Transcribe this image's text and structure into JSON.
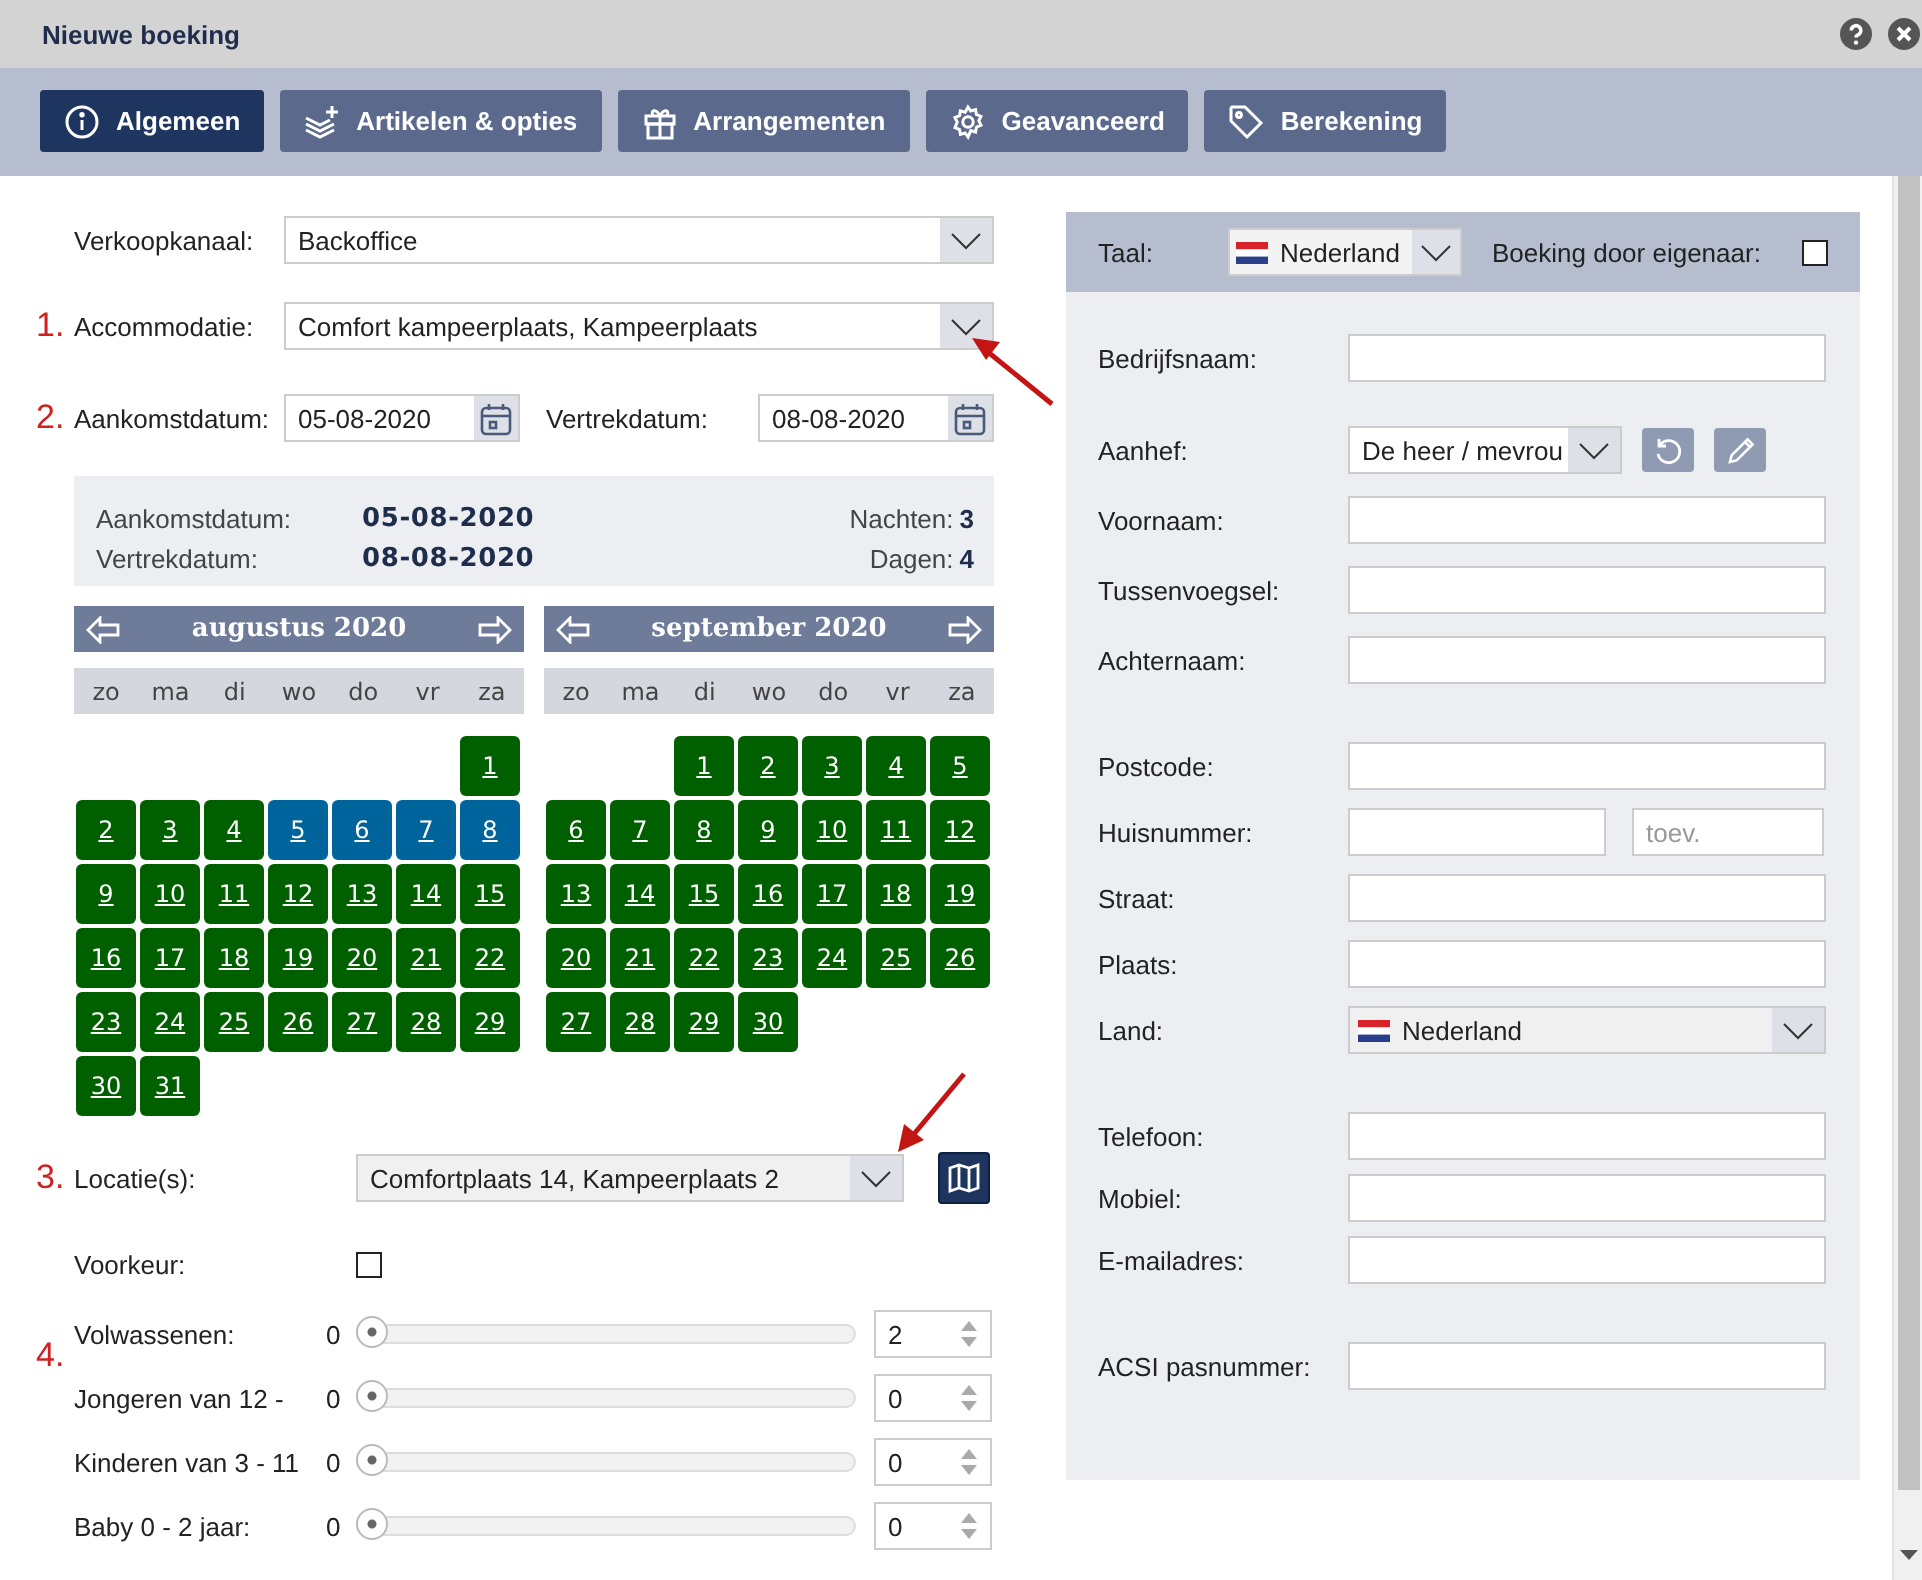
{
  "window": {
    "title": "Nieuwe boeking"
  },
  "tabs": [
    {
      "label": "Algemeen",
      "selected": true
    },
    {
      "label": "Artikelen & opties",
      "selected": false
    },
    {
      "label": "Arrangementen",
      "selected": false
    },
    {
      "label": "Geavanceerd",
      "selected": false
    },
    {
      "label": "Berekening",
      "selected": false
    }
  ],
  "booking": {
    "sales_channel": {
      "label": "Verkoopkanaal:",
      "value": "Backoffice"
    },
    "accommodation": {
      "marker": "1.",
      "label": "Accommodatie:",
      "value": "Comfort kampeerplaats, Kampeerplaats"
    },
    "dates": {
      "marker": "2.",
      "arrival_label": "Aankomstdatum:",
      "arrival": "05-08-2020",
      "departure_label": "Vertrekdatum:",
      "departure": "08-08-2020"
    },
    "summary": {
      "arrival_label": "Aankomstdatum:",
      "arrival": "05-08-2020",
      "departure_label": "Vertrekdatum:",
      "departure": "08-08-2020",
      "nights_label": "Nachten:",
      "nights": "3",
      "days_label": "Dagen:",
      "days": "4"
    },
    "calendars": [
      {
        "month": "augustus 2020",
        "weekdays": [
          "zo",
          "ma",
          "di",
          "wo",
          "do",
          "vr",
          "za"
        ],
        "weeks": [
          [
            {
              "day": "1",
              "selected": false
            }
          ],
          [
            {
              "day": "2",
              "selected": false
            },
            {
              "day": "3",
              "selected": false
            },
            {
              "day": "4",
              "selected": false
            },
            {
              "day": "5",
              "selected": true
            },
            {
              "day": "6",
              "selected": true
            },
            {
              "day": "7",
              "selected": true
            },
            {
              "day": "8",
              "selected": true
            }
          ],
          [
            {
              "day": "9",
              "selected": false
            },
            {
              "day": "10",
              "selected": false
            },
            {
              "day": "11",
              "selected": false
            },
            {
              "day": "12",
              "selected": false
            },
            {
              "day": "13",
              "selected": false
            },
            {
              "day": "14",
              "selected": false
            },
            {
              "day": "15",
              "selected": false
            }
          ],
          [
            {
              "day": "16",
              "selected": false
            },
            {
              "day": "17",
              "selected": false
            },
            {
              "day": "18",
              "selected": false
            },
            {
              "day": "19",
              "selected": false
            },
            {
              "day": "20",
              "selected": false
            },
            {
              "day": "21",
              "selected": false
            },
            {
              "day": "22",
              "selected": false
            }
          ],
          [
            {
              "day": "23",
              "selected": false
            },
            {
              "day": "24",
              "selected": false
            },
            {
              "day": "25",
              "selected": false
            },
            {
              "day": "26",
              "selected": false
            },
            {
              "day": "27",
              "selected": false
            },
            {
              "day": "28",
              "selected": false
            },
            {
              "day": "29",
              "selected": false
            }
          ],
          [
            {
              "day": "30",
              "selected": false
            },
            {
              "day": "31",
              "selected": false
            }
          ]
        ]
      },
      {
        "month": "september 2020",
        "weekdays": [
          "zo",
          "ma",
          "di",
          "wo",
          "do",
          "vr",
          "za"
        ],
        "weeks": [
          [
            {
              "day": "1",
              "selected": false
            },
            {
              "day": "2",
              "selected": false
            },
            {
              "day": "3",
              "selected": false
            },
            {
              "day": "4",
              "selected": false
            },
            {
              "day": "5",
              "selected": false
            }
          ],
          [
            {
              "day": "6",
              "selected": false
            },
            {
              "day": "7",
              "selected": false
            },
            {
              "day": "8",
              "selected": false
            },
            {
              "day": "9",
              "selected": false
            },
            {
              "day": "10",
              "selected": false
            },
            {
              "day": "11",
              "selected": false
            },
            {
              "day": "12",
              "selected": false
            }
          ],
          [
            {
              "day": "13",
              "selected": false
            },
            {
              "day": "14",
              "selected": false
            },
            {
              "day": "15",
              "selected": false
            },
            {
              "day": "16",
              "selected": false
            },
            {
              "day": "17",
              "selected": false
            },
            {
              "day": "18",
              "selected": false
            },
            {
              "day": "19",
              "selected": false
            }
          ],
          [
            {
              "day": "20",
              "selected": false
            },
            {
              "day": "21",
              "selected": false
            },
            {
              "day": "22",
              "selected": false
            },
            {
              "day": "23",
              "selected": false
            },
            {
              "day": "24",
              "selected": false
            },
            {
              "day": "25",
              "selected": false
            },
            {
              "day": "26",
              "selected": false
            }
          ],
          [
            {
              "day": "27",
              "selected": false
            },
            {
              "day": "28",
              "selected": false
            },
            {
              "day": "29",
              "selected": false
            },
            {
              "day": "30",
              "selected": false
            }
          ]
        ]
      }
    ],
    "location": {
      "marker": "3.",
      "label": "Locatie(s):",
      "value": "Comfortplaats 14, Kampeerplaats 2"
    },
    "preference": {
      "label": "Voorkeur:",
      "checked": false
    },
    "guests": {
      "marker": "4.",
      "rows": [
        {
          "label": "Volwassenen:",
          "min": "0",
          "level": 0,
          "value": "2"
        },
        {
          "label": "Jongeren van 12 -",
          "min": "0",
          "level": 0,
          "value": "0"
        },
        {
          "label": "Kinderen van 3 - 11",
          "min": "0",
          "level": 0,
          "value": "0"
        },
        {
          "label": "Baby 0 - 2 jaar:",
          "min": "0",
          "level": 0,
          "value": "0"
        }
      ]
    }
  },
  "customer": {
    "language": {
      "label": "Taal:",
      "value": "Nederland"
    },
    "owner_booking": {
      "label": "Boeking door eigenaar:",
      "checked": false
    },
    "groups": [
      [
        {
          "kind": "text",
          "label": "Bedrijfsnaam:"
        },
        {
          "kind": "salutation",
          "label": "Aanhef:",
          "value": "De heer / mevrou"
        },
        {
          "kind": "text",
          "label": "Voornaam:"
        },
        {
          "kind": "text",
          "label": "Tussenvoegsel:"
        },
        {
          "kind": "text",
          "label": "Achternaam:"
        }
      ],
      [
        {
          "kind": "text",
          "label": "Postcode:"
        },
        {
          "kind": "split",
          "label": "Huisnummer:",
          "placeholder": "toev."
        },
        {
          "kind": "text",
          "label": "Straat:"
        },
        {
          "kind": "text",
          "label": "Plaats:"
        },
        {
          "kind": "country",
          "label": "Land:",
          "value": "Nederland"
        }
      ],
      [
        {
          "kind": "text",
          "label": "Telefoon:"
        },
        {
          "kind": "text",
          "label": "Mobiel:"
        },
        {
          "kind": "text",
          "label": "E-mailadres:"
        }
      ],
      [
        {
          "kind": "text",
          "label": "ACSI pasnummer:"
        }
      ]
    ]
  }
}
